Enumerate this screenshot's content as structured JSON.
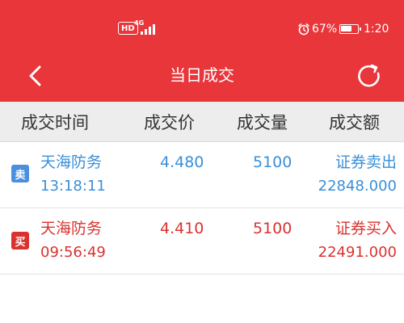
{
  "status_bar": {
    "hd": "HD",
    "network": "4G",
    "battery": "67%",
    "battery_level": 0.67,
    "time": "1:20",
    "icons": [
      "signal-icon",
      "alarm-icon",
      "battery-icon"
    ]
  },
  "toolbar": {
    "title": "当日成交",
    "back_icon": "chevron-left-icon",
    "refresh_icon": "refresh-icon"
  },
  "colors": {
    "header": "#e8363a",
    "sell": "#3a8fd9",
    "buy": "#d9332f"
  },
  "table": {
    "headers": [
      "成交时间",
      "成交价",
      "成交量",
      "成交额"
    ],
    "rows": [
      {
        "badge": "卖",
        "name": "天海防务",
        "time": "13:18:11",
        "price": "4.480",
        "quantity": "5100",
        "action": "证券卖出",
        "amount": "22848.000"
      },
      {
        "badge": "买",
        "name": "天海防务",
        "time": "09:56:49",
        "price": "4.410",
        "quantity": "5100",
        "action": "证券买入",
        "amount": "22491.000"
      }
    ]
  }
}
